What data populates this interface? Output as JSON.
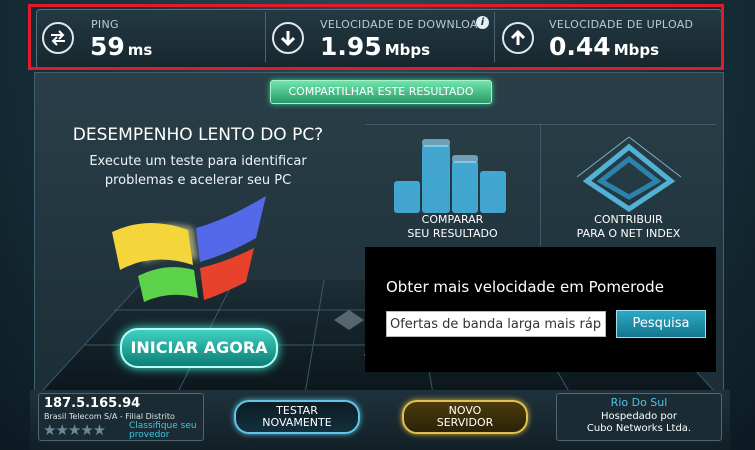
{
  "stats": {
    "ping": {
      "label": "PING",
      "value": "59",
      "unit": "ms",
      "icon": "ping-arrows-icon"
    },
    "download": {
      "label": "VELOCIDADE DE DOWNLOAD",
      "value": "1.95",
      "unit": "Mbps",
      "icon": "download-arrow-icon",
      "info": "i"
    },
    "upload": {
      "label": "VELOCIDADE DE UPLOAD",
      "value": "0.44",
      "unit": "Mbps",
      "icon": "upload-arrow-icon"
    }
  },
  "share": {
    "label": "COMPARTILHAR ESTE RESULTADO"
  },
  "promo": {
    "title": "DESEMPENHO LENTO DO PC?",
    "subtitle_line1": "Execute um teste para identificar",
    "subtitle_line2": "problemas e acelerar seu PC",
    "start_button": "INICIAR AGORA"
  },
  "tiles": {
    "compare": {
      "line1": "COMPARAR",
      "line2": "SEU RESULTADO"
    },
    "contribute": {
      "line1": "CONTRIBUIR",
      "line2": "PARA O NET INDEX"
    }
  },
  "offer": {
    "title": "Obter mais velocidade em Pomerode",
    "input_value": "Ofertas de banda larga mais ráp",
    "search_button": "Pesquisa"
  },
  "isp": {
    "ip": "187.5.165.94",
    "name": "Brasil Telecom S/A - Filial Distrito",
    "stars": "★★★★★",
    "rate_line1": "Classifique seu",
    "rate_line2": "provedor"
  },
  "buttons": {
    "retest_line1": "TESTAR",
    "retest_line2": "NOVAMENTE",
    "new_server_line1": "NOVO",
    "new_server_line2": "SERVIDOR"
  },
  "server": {
    "city": "Rio Do Sul",
    "hosted_line1": "Hospedado por",
    "hosted_line2": "Cubo Networks Ltda."
  },
  "colors": {
    "highlight": "#e21b2a",
    "share_green": "#34d28a",
    "retest_blue": "#62c5e8",
    "new_server_gold": "#e2c04d",
    "server_city": "#4fc3e8"
  }
}
